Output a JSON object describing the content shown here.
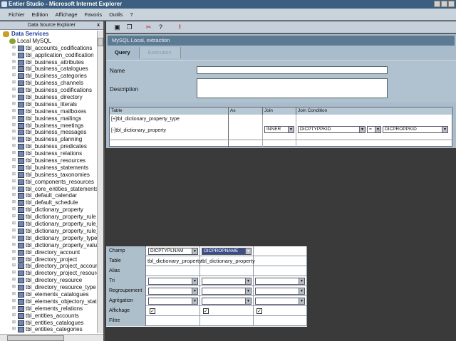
{
  "window": {
    "title": "Entier Studio - Microsoft Internet Explorer"
  },
  "menu": [
    "Fichier",
    "Edition",
    "Affichage",
    "Favoris",
    "Outils",
    "?"
  ],
  "explorer": {
    "title": "Data Source Explorer",
    "close": "x",
    "root": "Data Services",
    "connection": "Local MySQL",
    "tables": [
      "tbl_accounts_codifications",
      "tbl_application_codification",
      "tbl_business_attributes",
      "tbl_business_catalogues",
      "tbl_business_categories",
      "tbl_business_channels",
      "tbl_business_codifications",
      "tbl_business_directory",
      "tbl_business_literals",
      "tbl_business_mailboxes",
      "tbl_business_mailings",
      "tbl_business_meetings",
      "tbl_business_messages",
      "tbl_business_planning",
      "tbl_business_predicates",
      "tbl_business_relations",
      "tbl_business_resources",
      "tbl_business_statements",
      "tbl_business_taxonomies",
      "tbl_components_resources",
      "tbl_core_entities_statements",
      "tbl_default_calendar",
      "tbl_default_schedule",
      "tbl_dictionary_property",
      "tbl_dictionary_property_rule",
      "tbl_dictionary_property_rule_r",
      "tbl_dictionary_property_rule_t",
      "tbl_dictionary_property_type",
      "tbl_dictionary_property_value",
      "tbl_directory_account",
      "tbl_directory_project",
      "tbl_directory_project_account",
      "tbl_directory_project_resource",
      "tbl_directory_resource",
      "tbl_directory_resource_type",
      "tbl_elements_catalogues",
      "tbl_elements_objectory_state",
      "tbl_elements_relations",
      "tbl_entities_accounts",
      "tbl_entities_catalogues",
      "tbl_entities_categories"
    ]
  },
  "panel": {
    "title": "MySQL Local, extraction",
    "tabs": [
      "Query",
      "Execution"
    ],
    "name_label": "Name",
    "name_value": "",
    "description_label": "Description",
    "description_value": ""
  },
  "join": {
    "headers": [
      "Table",
      "As",
      "Join",
      "Join Condition"
    ],
    "rows": [
      {
        "table": "tbl_dictionary_property_type",
        "marker": "[+]"
      },
      {
        "table": "tbl_dictionary_property",
        "marker": "[-]",
        "join": "INNER",
        "left": "DICPTYPPKID",
        "op": "=",
        "right": "DICPROPPKID"
      }
    ]
  },
  "fields": {
    "labels": [
      "Champ",
      "Table",
      "Alias",
      "Tri",
      "Regroupement",
      "Agrégation",
      "Affichage",
      "Filtre"
    ],
    "columns": [
      {
        "champ": "DICPTYPLNAM",
        "table": "tbl_dictionary_property",
        "affichage": true
      },
      {
        "champ": "DICPROPNAME",
        "table": "tbl_dictionary_property",
        "affichage": true
      },
      {
        "champ": "",
        "table": "",
        "affichage": true
      }
    ]
  }
}
